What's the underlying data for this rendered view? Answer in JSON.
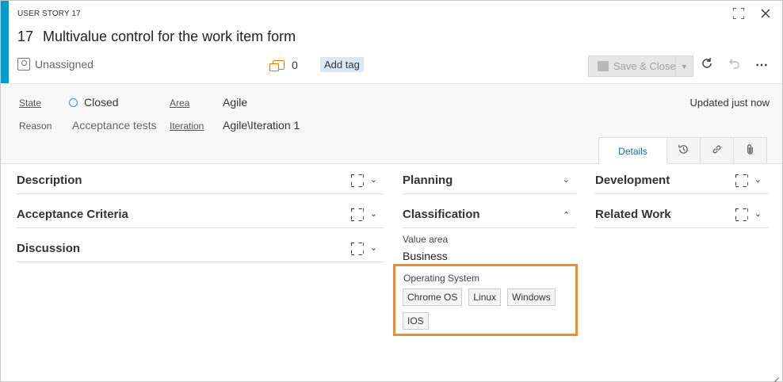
{
  "work_item": {
    "type_label": "USER STORY 17",
    "id": "17",
    "title": "Multivalue control for the work item form",
    "assignee": "Unassigned",
    "comment_count": "0",
    "add_tag_label": "Add tag",
    "save_label": "Save & Close",
    "updated_text": "Updated just now"
  },
  "fields": {
    "state_label": "State",
    "state_value": "Closed",
    "reason_label": "Reason",
    "reason_value": "Acceptance tests",
    "area_label": "Area",
    "area_value": "Agile",
    "iteration_label": "Iteration",
    "iteration_value": "Agile\\Iteration 1"
  },
  "tabs": {
    "details_label": "Details"
  },
  "sections": {
    "description": "Description",
    "acceptance_criteria": "Acceptance Criteria",
    "discussion": "Discussion",
    "planning": "Planning",
    "classification": "Classification",
    "development": "Development",
    "related_work": "Related Work"
  },
  "classification": {
    "value_area_label": "Value area",
    "value_area_value": "Business",
    "os_label": "Operating System",
    "os_values": [
      "Chrome OS",
      "Linux",
      "Windows",
      "IOS"
    ]
  },
  "colors": {
    "accent": "#009ccc",
    "highlight_border": "#f28c28",
    "comment_icon": "#e07c00",
    "tag_background": "#dae8f4"
  }
}
